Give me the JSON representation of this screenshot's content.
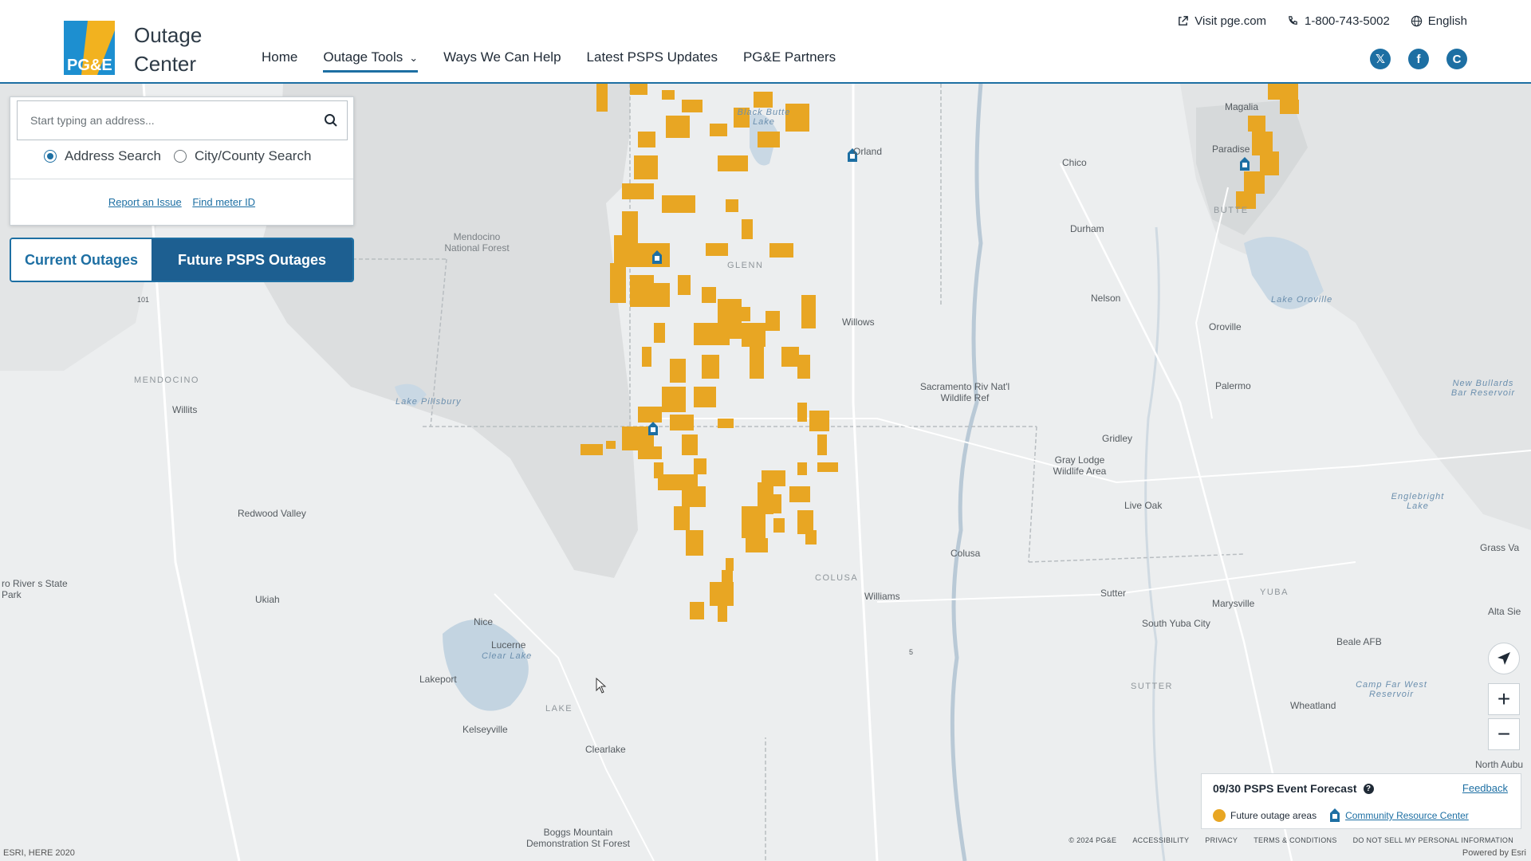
{
  "header": {
    "logo_text": "PG&E",
    "title_line1": "Outage",
    "title_line2": "Center",
    "nav": [
      {
        "label": "Home"
      },
      {
        "label": "Outage Tools"
      },
      {
        "label": "Ways We Can Help"
      },
      {
        "label": "Latest PSPS Updates"
      },
      {
        "label": "PG&E Partners"
      }
    ],
    "utility": {
      "visit": "Visit pge.com",
      "phone": "1-800-743-5002",
      "language": "English"
    },
    "social_icons": [
      "x-icon",
      "facebook-icon",
      "c-icon"
    ]
  },
  "search": {
    "placeholder": "Start typing an address...",
    "options": [
      {
        "label": "Address Search",
        "checked": true
      },
      {
        "label": "City/County Search",
        "checked": false
      }
    ],
    "links": [
      "Report an Issue",
      "Find meter ID"
    ]
  },
  "toggle": {
    "current": "Current Outages",
    "future": "Future PSPS Outages",
    "selected": "Future PSPS Outages"
  },
  "map": {
    "labels": [
      {
        "text": "Chico",
        "type": "city"
      },
      {
        "text": "Magalia",
        "type": "city"
      },
      {
        "text": "Paradise",
        "type": "city"
      },
      {
        "text": "Butte",
        "type": "county"
      },
      {
        "text": "Durham",
        "type": "city"
      },
      {
        "text": "Nelson",
        "type": "city"
      },
      {
        "text": "Oroville",
        "type": "city"
      },
      {
        "text": "Lake Oroville",
        "type": "water"
      },
      {
        "text": "Palermo",
        "type": "city"
      },
      {
        "text": "New Bullards Bar Reservoir",
        "type": "water"
      },
      {
        "text": "Gridley",
        "type": "city"
      },
      {
        "text": "Live Oak",
        "type": "city"
      },
      {
        "text": "Englebright Lake",
        "type": "water"
      },
      {
        "text": "Grass Va",
        "type": "city"
      },
      {
        "text": "Yuba",
        "type": "county"
      },
      {
        "text": "Marysville",
        "type": "city"
      },
      {
        "text": "Sutter",
        "type": "city"
      },
      {
        "text": "South Yuba City",
        "type": "city"
      },
      {
        "text": "Alta Sie",
        "type": "city"
      },
      {
        "text": "Beale AFB",
        "type": "city"
      },
      {
        "text": "Sutter",
        "type": "county"
      },
      {
        "text": "Camp Far West Reservoir",
        "type": "water"
      },
      {
        "text": "Wheatland",
        "type": "city"
      },
      {
        "text": "North Aubu",
        "type": "city"
      },
      {
        "text": "Orland",
        "type": "city"
      },
      {
        "text": "Black Butte Lake",
        "type": "water"
      },
      {
        "text": "Mendocino National Forest",
        "type": "city"
      },
      {
        "text": "Glenn",
        "type": "county"
      },
      {
        "text": "Willows",
        "type": "city"
      },
      {
        "text": "Sacramento Riv Nat'l Wildlife Ref",
        "type": "city"
      },
      {
        "text": "Gray Lodge Wildlife Area",
        "type": "city"
      },
      {
        "text": "Mendocino",
        "type": "county"
      },
      {
        "text": "Willits",
        "type": "city"
      },
      {
        "text": "Lake Pillsbury",
        "type": "water"
      },
      {
        "text": "Redwood Valley",
        "type": "city"
      },
      {
        "text": "Colusa",
        "type": "city"
      },
      {
        "text": "Colusa",
        "type": "county"
      },
      {
        "text": "Williams",
        "type": "city"
      },
      {
        "text": "Ukiah",
        "type": "city"
      },
      {
        "text": "Nice",
        "type": "city"
      },
      {
        "text": "Lucerne",
        "type": "city"
      },
      {
        "text": "Clear Lake",
        "type": "water"
      },
      {
        "text": "Lakeport",
        "type": "city"
      },
      {
        "text": "Lake",
        "type": "county"
      },
      {
        "text": "Kelseyville",
        "type": "city"
      },
      {
        "text": "Clearlake",
        "type": "city"
      },
      {
        "text": "Boggs Mountain Demonstration St Forest",
        "type": "city"
      },
      {
        "text": "ro River s State Park",
        "type": "city"
      },
      {
        "text": "101",
        "type": "city"
      },
      {
        "text": "5",
        "type": "city"
      }
    ]
  },
  "legend": {
    "title": "09/30 PSPS Event Forecast",
    "feedback": "Feedback",
    "future_label": "Future outage areas",
    "community_label": "Community Resource Center",
    "colors": {
      "future": "#e8a623",
      "accent": "#1d6fa3"
    }
  },
  "footer": {
    "copyright": "© 2024 PG&E",
    "links": [
      "ACCESSIBILITY",
      "PRIVACY",
      "TERMS & CONDITIONS",
      "DO NOT SELL MY PERSONAL INFORMATION"
    ],
    "attribution": "ESRI, HERE 2020",
    "powered": "Powered by Esri"
  }
}
